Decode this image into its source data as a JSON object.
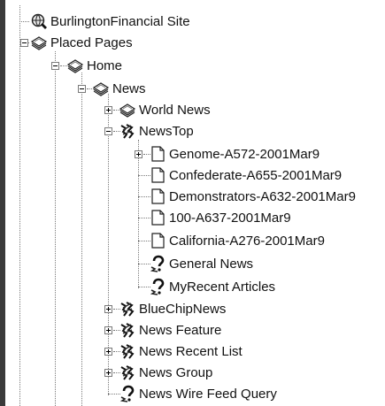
{
  "tree": {
    "nodes": [
      {
        "label": "BurlingtonFinancial Site",
        "icon": "globe-search-icon"
      },
      {
        "label": "Placed Pages",
        "icon": "pages-stack-icon"
      },
      {
        "label": "Home",
        "icon": "pages-stack-icon"
      },
      {
        "label": "News",
        "icon": "pages-stack-icon"
      },
      {
        "label": "World News",
        "icon": "pages-stack-icon"
      },
      {
        "label": "NewsTop",
        "icon": "puzzle-component-icon"
      },
      {
        "label": "Genome-A572-2001Mar9",
        "icon": "document-icon"
      },
      {
        "label": "Confederate-A655-2001Mar9",
        "icon": "document-icon"
      },
      {
        "label": "Demonstrators-A632-2001Mar9",
        "icon": "document-icon"
      },
      {
        "label": "100-A637-2001Mar9",
        "icon": "document-icon"
      },
      {
        "label": "California-A276-2001Mar9",
        "icon": "document-icon"
      },
      {
        "label": "General News",
        "icon": "query-icon"
      },
      {
        "label": "MyRecent Articles",
        "icon": "query-icon"
      },
      {
        "label": "BlueChipNews",
        "icon": "puzzle-component-icon"
      },
      {
        "label": "News Feature",
        "icon": "puzzle-component-icon"
      },
      {
        "label": "News Recent List",
        "icon": "puzzle-component-icon"
      },
      {
        "label": "News Group",
        "icon": "puzzle-component-icon"
      },
      {
        "label": "News Wire Feed Query",
        "icon": "query-icon"
      }
    ]
  }
}
